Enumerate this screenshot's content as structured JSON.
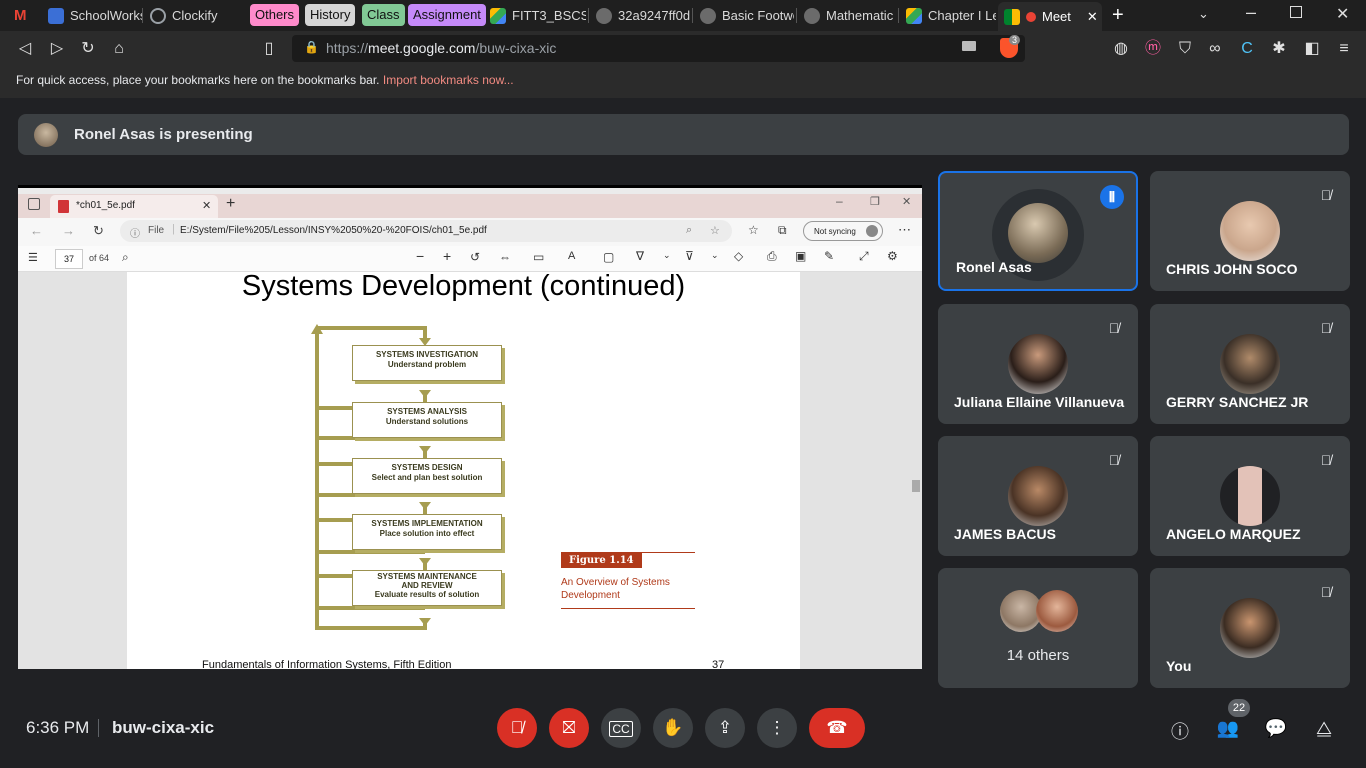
{
  "browser": {
    "tabs": [
      {
        "label": "SchoolWorks"
      },
      {
        "label": "Clockify"
      },
      {
        "label": "FITT3_BSCS2"
      },
      {
        "label": "32a9247ff0d"
      },
      {
        "label": "Basic Footwo"
      },
      {
        "label": "Mathematic"
      },
      {
        "label": "Chapter I Le"
      },
      {
        "label": "Meet"
      }
    ],
    "groups": [
      {
        "label": "Others",
        "color": "#ff8bcb"
      },
      {
        "label": "History",
        "color": "#d5d5d5"
      },
      {
        "label": "Class",
        "color": "#81c995"
      },
      {
        "label": "Assignment",
        "color": "#c58af9"
      }
    ],
    "url_prefix": "https://",
    "url_host": "meet.google.com",
    "url_path": "/buw-cixa-xic",
    "brave_count": "3",
    "bookmarks_text": "For quick access, place your bookmarks here on the bookmarks bar.",
    "bookmarks_link": "Import bookmarks now..."
  },
  "meet": {
    "presenting_text": "Ronel Asas is presenting",
    "time": "6:36 PM",
    "meeting_code": "buw-cixa-xic",
    "people_count": "22",
    "participants": [
      {
        "name": "Ronel Asas",
        "speaking": true
      },
      {
        "name": "CHRIS JOHN SOCO"
      },
      {
        "name": "Juliana Ellaine Villanueva"
      },
      {
        "name": "GERRY SANCHEZ JR"
      },
      {
        "name": "JAMES BACUS"
      },
      {
        "name": "ANGELO MARQUEZ"
      },
      {
        "name": "You"
      }
    ],
    "others_label": "14 others"
  },
  "pdf": {
    "tab_title": "*ch01_5e.pdf",
    "file_label": "File",
    "file_path": "E:/System/File%205/Lesson/INSY%2050%20-%20FOIS/ch01_5e.pdf",
    "sync_label": "Not syncing",
    "page_number": "37",
    "page_total": "of 64",
    "slide_title": "Systems Development (continued)",
    "stages": [
      {
        "title": "SYSTEMS INVESTIGATION",
        "sub": "Understand problem"
      },
      {
        "title": "SYSTEMS ANALYSIS",
        "sub": "Understand solutions"
      },
      {
        "title": "SYSTEMS DESIGN",
        "sub": "Select and plan best solution"
      },
      {
        "title": "SYSTEMS IMPLEMENTATION",
        "sub": "Place solution into effect"
      },
      {
        "title": "SYSTEMS MAINTENANCE AND REVIEW",
        "sub": "Evaluate results of solution"
      }
    ],
    "figure_label": "Figure 1.14",
    "figure_caption": "An Overview of Systems Development",
    "footer_left": "Fundamentals of Information Systems, Fifth Edition",
    "footer_right": "37"
  }
}
